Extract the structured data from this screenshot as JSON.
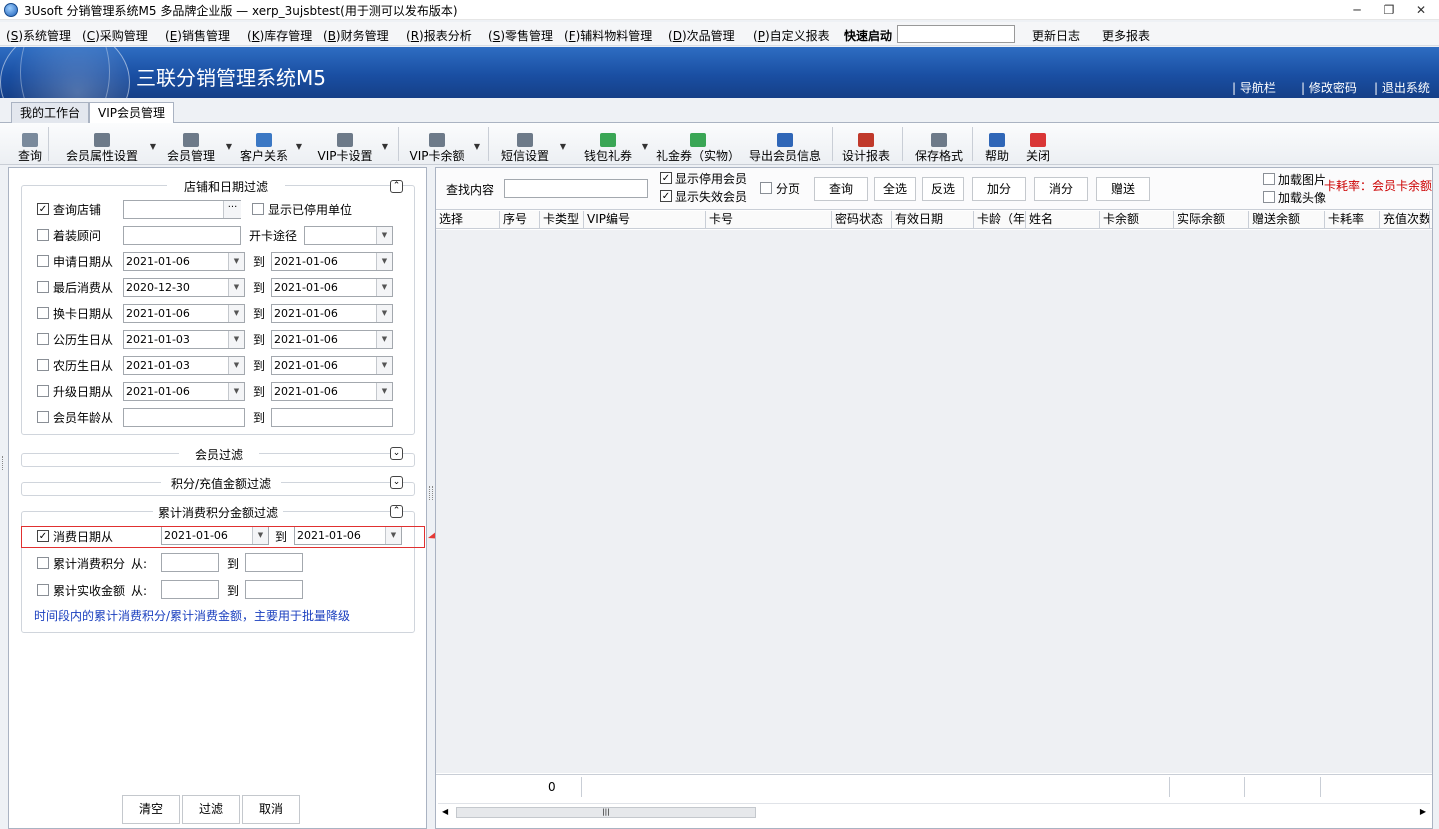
{
  "window": {
    "title": "3Usoft 分销管理系统M5 多品牌企业版 — xerp_3ujsbtest(用于测可以发布版本)"
  },
  "menu": {
    "items": [
      {
        "key": "S",
        "label": "系统管理"
      },
      {
        "key": "C",
        "label": "采购管理"
      },
      {
        "key": "E",
        "label": "销售管理"
      },
      {
        "key": "K",
        "label": "库存管理"
      },
      {
        "key": "B",
        "label": "财务管理"
      },
      {
        "key": "R",
        "label": "报表分析"
      },
      {
        "key": "S",
        "label": "零售管理"
      },
      {
        "key": "F",
        "label": "辅料物料管理"
      },
      {
        "key": "D",
        "label": "次品管理"
      },
      {
        "key": "P",
        "label": "自定义报表"
      }
    ],
    "quick_start": "快速启动",
    "update_log": "更新日志",
    "more_reports": "更多报表"
  },
  "banner": {
    "app_title": "三联分销管理系统M5",
    "links": [
      "导航栏",
      "修改密码",
      "退出系统"
    ]
  },
  "tabs": [
    "我的工作台",
    "VIP会员管理"
  ],
  "toolbar": [
    {
      "label": "查询",
      "icon": "pen-icon",
      "color": "#7a8a9c",
      "dropdown": false
    },
    {
      "label": "会员属性设置",
      "icon": "gear-card-icon",
      "color": "#6d7a89",
      "dropdown": true
    },
    {
      "label": "会员管理",
      "icon": "card-icon",
      "color": "#6d7a89",
      "dropdown": true
    },
    {
      "label": "客户关系",
      "icon": "network-icon",
      "color": "#3b78c4",
      "dropdown": true
    },
    {
      "label": "VIP卡设置",
      "icon": "card-icon",
      "color": "#6d7a89",
      "dropdown": true
    },
    {
      "label": "VIP卡余额",
      "icon": "card-icon",
      "color": "#6d7a89",
      "dropdown": true
    },
    {
      "label": "短信设置",
      "icon": "gear-card-icon",
      "color": "#6d7a89",
      "dropdown": true
    },
    {
      "label": "钱包礼券",
      "icon": "gift-icon",
      "color": "#3aa655",
      "dropdown": true
    },
    {
      "label": "礼金券（实物）",
      "icon": "yen-icon",
      "color": "#3aa655",
      "dropdown": false
    },
    {
      "label": "导出会员信息",
      "icon": "floppy-icon",
      "color": "#2f66b7",
      "dropdown": false
    },
    {
      "label": "设计报表",
      "icon": "report-design-icon",
      "color": "#c0392b",
      "dropdown": false
    },
    {
      "label": "保存格式",
      "icon": "printer-icon",
      "color": "#6d7a89",
      "dropdown": false
    },
    {
      "label": "帮助",
      "icon": "help-icon",
      "color": "#2f66b7",
      "dropdown": false
    },
    {
      "label": "关闭",
      "icon": "power-icon",
      "color": "#d93636",
      "dropdown": false
    }
  ],
  "filters": {
    "store_date": {
      "title": "店铺和日期过滤",
      "query_store": {
        "checked": true,
        "label": "查询店铺",
        "value": "",
        "show_disabled_label": "显示已停用单位",
        "show_disabled": false
      },
      "consultant": {
        "checked": false,
        "label": "着装顾问",
        "value": "",
        "card_channel_label": "开卡途径",
        "card_channel": ""
      },
      "to_label": "到",
      "date_rows": [
        {
          "label": "申请日期从",
          "checked": false,
          "from": "2021-01-06",
          "to": "2021-01-06"
        },
        {
          "label": "最后消费从",
          "checked": false,
          "from": "2020-12-30",
          "to": "2021-01-06"
        },
        {
          "label": "换卡日期从",
          "checked": false,
          "from": "2021-01-06",
          "to": "2021-01-06"
        },
        {
          "label": "公历生日从",
          "checked": false,
          "from": "2021-01-03",
          "to": "2021-01-06"
        },
        {
          "label": "农历生日从",
          "checked": false,
          "from": "2021-01-03",
          "to": "2021-01-06"
        },
        {
          "label": "升级日期从",
          "checked": false,
          "from": "2021-01-06",
          "to": "2021-01-06"
        }
      ],
      "age": {
        "label": "会员年龄从",
        "checked": false,
        "from": "",
        "to": ""
      }
    },
    "member": {
      "title": "会员过滤"
    },
    "points": {
      "title": "积分/充值金额过滤"
    },
    "cumulative": {
      "title": "累计消费积分金额过滤",
      "date": {
        "label": "消费日期从",
        "checked": true,
        "from": "2021-01-06",
        "to_label": "到",
        "to": "2021-01-06"
      },
      "points": {
        "label": "累计消费积分",
        "from_label": "从:",
        "to_label": "到",
        "checked": false
      },
      "amount": {
        "label": "累计实收金额",
        "from_label": "从:",
        "to_label": "到",
        "checked": false
      },
      "hint": "时间段内的累计消费积分/累计消费金额，主要用于批量降级"
    }
  },
  "left_buttons": {
    "clear": "清空",
    "filter": "过滤",
    "cancel": "取消"
  },
  "search": {
    "label": "查找内容",
    "value": "",
    "show_disabled": {
      "label": "显示停用会员",
      "checked": true
    },
    "show_invalid": {
      "label": "显示失效会员",
      "checked": true
    },
    "paging": {
      "label": "分页",
      "checked": false
    },
    "buttons": [
      "查询",
      "全选",
      "反选",
      "加分",
      "消分",
      "赠送"
    ],
    "load_image": {
      "label": "加载图片",
      "checked": false
    },
    "load_avatar": {
      "label": "加载头像",
      "checked": false
    },
    "note": "卡耗率：会员卡余额",
    "note_color": "#cc0000"
  },
  "grid": {
    "columns": [
      "选择",
      "序号",
      "卡类型",
      "VIP编号",
      "卡号",
      "密码状态",
      "有效日期",
      "卡龄（年）",
      "姓名",
      "卡余额",
      "实际余额",
      "赠送余额",
      "卡耗率",
      "充值次数"
    ],
    "footer_count": "0"
  }
}
